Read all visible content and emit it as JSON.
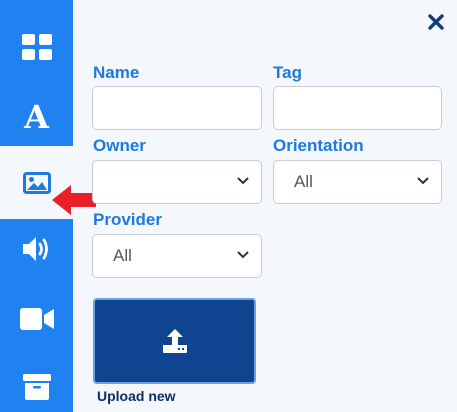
{
  "sidebar": {
    "items": [
      {
        "name": "layout",
        "icon": "grid-icon"
      },
      {
        "name": "text",
        "icon": "letter-a-icon",
        "glyph": "A"
      },
      {
        "name": "images",
        "icon": "image-icon",
        "active": true
      },
      {
        "name": "audio",
        "icon": "speaker-icon"
      },
      {
        "name": "video",
        "icon": "video-camera-icon"
      },
      {
        "name": "archive",
        "icon": "archive-box-icon"
      }
    ]
  },
  "panel": {
    "close_icon": "close-icon",
    "name": {
      "label": "Name",
      "value": ""
    },
    "tag": {
      "label": "Tag",
      "value": ""
    },
    "owner": {
      "label": "Owner",
      "selected": ""
    },
    "orientation": {
      "label": "Orientation",
      "selected": "All"
    },
    "provider": {
      "label": "Provider",
      "selected": "All"
    },
    "upload": {
      "label": "Upload new",
      "icon": "upload-icon"
    }
  },
  "colors": {
    "sidebar": "#1f82f0",
    "label": "#1f7ae0",
    "upload_button": "#0f4490",
    "arrow": "#e8202a"
  }
}
